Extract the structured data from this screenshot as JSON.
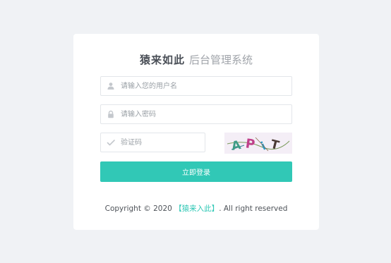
{
  "header": {
    "brand": "猿来如此",
    "subtitle": "后台管理系统"
  },
  "form": {
    "username_placeholder": "请输入您的用户名",
    "password_placeholder": "请输入密码",
    "captcha_placeholder": "验证码",
    "captcha_chars": [
      "A",
      "P",
      "i",
      "T"
    ],
    "login_label": "立即登录"
  },
  "footer": {
    "prefix": "Copyright © 2020",
    "link": "【猿来入此】",
    "suffix": ". All right reserved"
  },
  "colors": {
    "accent": "#31c8b6",
    "background": "#f0f2f5",
    "card": "#ffffff"
  },
  "icons": {
    "username": "user-icon",
    "password": "lock-icon",
    "captcha": "check-icon"
  }
}
